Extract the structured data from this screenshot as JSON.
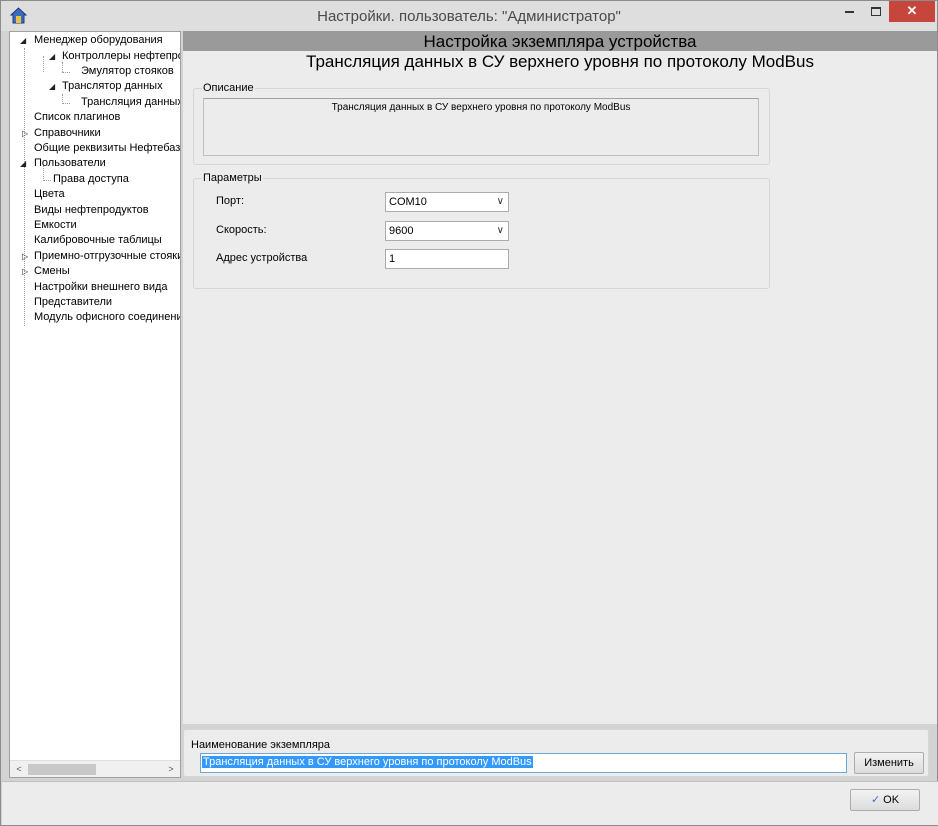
{
  "window": {
    "title": "Настройки. пользователь: \"Администратор\"",
    "close_glyph": "✕"
  },
  "tree": {
    "items": [
      {
        "label": "Менеджер оборудования",
        "expanded": true
      },
      {
        "label": "Контроллеры нефтепрод",
        "expanded": true
      },
      {
        "label": "Эмулятор стояков"
      },
      {
        "label": "Транслятор данных",
        "expanded": true
      },
      {
        "label": "Трансляция данных в",
        "selected": true
      },
      {
        "label": "Список плагинов"
      },
      {
        "label": "Справочники",
        "expandable": true
      },
      {
        "label": "Общие реквизиты Нефтебазы"
      },
      {
        "label": "Пользователи",
        "expanded": true
      },
      {
        "label": "Права доступа"
      },
      {
        "label": "Цвета"
      },
      {
        "label": "Виды нефтепродуктов"
      },
      {
        "label": "Емкости"
      },
      {
        "label": "Калибровочные таблицы"
      },
      {
        "label": "Приемно-отгрузочные стояки",
        "expandable": true
      },
      {
        "label": "Смены",
        "expandable": true
      },
      {
        "label": "Настройки внешнего вида"
      },
      {
        "label": "Представители"
      },
      {
        "label": "Модуль офисного соединения"
      }
    ],
    "scroll_left": "<",
    "scroll_right": ">"
  },
  "content": {
    "header": "Настройка экземпляра устройства",
    "subtitle": "Трансляция данных в СУ верхнего уровня по протоколу ModBus",
    "description": {
      "legend": "Описание",
      "text": "Трансляция данных в СУ верхнего уровня по протоколу ModBus"
    },
    "params": {
      "legend": "Параметры",
      "port_label": "Порт:",
      "port_value": "COM10",
      "speed_label": "Скорость:",
      "speed_value": "9600",
      "address_label": "Адрес устройства",
      "address_value": "1"
    }
  },
  "instance": {
    "label": "Наименование экземпляра",
    "value": "Трансляция данных в СУ верхнего уровня по протоколу ModBus",
    "change_button": "Изменить"
  },
  "footer": {
    "ok_button": "OK"
  }
}
